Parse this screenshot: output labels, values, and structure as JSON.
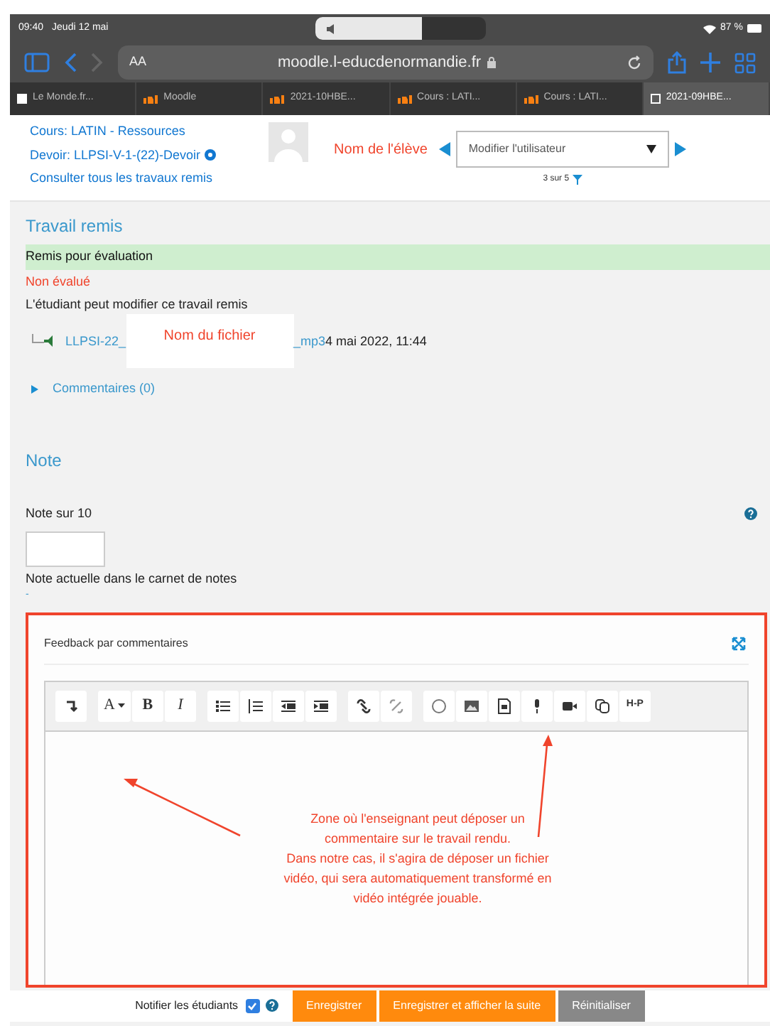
{
  "status_bar": {
    "time": "09:40",
    "date": "Jeudi 12 mai",
    "battery": "87 %"
  },
  "browser": {
    "text_size": "AA",
    "url": "moodle.l-educdenormandie.fr",
    "tabs": [
      {
        "label": "Le Monde.fr...",
        "selected": false
      },
      {
        "label": "Moodle",
        "selected": false
      },
      {
        "label": "2021-10HBE...",
        "selected": false
      },
      {
        "label": "Cours : LATI...",
        "selected": false
      },
      {
        "label": "Cours : LATI...",
        "selected": false
      },
      {
        "label": "2021-09HBE...",
        "selected": true
      }
    ]
  },
  "header": {
    "links": [
      "Cours: LATIN - Ressources",
      "Devoir: LLPSI-V-1-(22)-Devoir",
      "Consulter tous les travaux remis"
    ],
    "student_label": "Nom de l'élève",
    "user_select": "Modifier l'utilisateur",
    "counter": "3 sur 5"
  },
  "submission": {
    "title": "Travail remis",
    "status": "Remis pour évaluation",
    "grading": "Non évalué",
    "info": "L'étudiant peut modifier ce travail remis",
    "file_start": "LLPSI-22_",
    "file_end": "_mp3",
    "file_date": "4 mai 2022, 11:44",
    "file_label": "Nom du fichier",
    "comments": "Commentaires (0)",
    "comments_expanded": false
  },
  "grade": {
    "title": "Note",
    "label": "Note sur 10",
    "current_label": "Note actuelle dans le carnet de notes",
    "current_value": "-"
  },
  "feedback": {
    "title": "Feedback par commentaires",
    "toolbar": [
      [
        {
          "kind": "icon"
        }
      ],
      [
        {
          "kind": "text",
          "label": "A"
        },
        {
          "kind": "text",
          "label": "B"
        },
        {
          "kind": "text",
          "label": "I"
        }
      ],
      [
        {
          "kind": "icon"
        },
        {
          "kind": "icon"
        },
        {
          "kind": "icon"
        },
        {
          "kind": "icon"
        }
      ],
      [
        {
          "kind": "icon"
        },
        {
          "kind": "icon"
        }
      ],
      [
        {
          "kind": "icon"
        },
        {
          "kind": "icon"
        },
        {
          "kind": "icon"
        },
        {
          "kind": "icon"
        },
        {
          "kind": "icon"
        },
        {
          "kind": "icon"
        },
        {
          "kind": "text",
          "label": "H-P"
        }
      ]
    ],
    "note_lines": [
      "Zone où l'enseignant peut déposer un",
      "commentaire sur le travail rendu.",
      "Dans notre cas, il s'agira de déposer un fichier",
      "vidéo, qui sera automatiquement transformé en",
      "vidéo intégrée jouable."
    ]
  },
  "footer": {
    "notify_label": "Notifier les étudiants",
    "notify_checked": true,
    "buttons": [
      {
        "label": "Enregistrer",
        "kind": "primary"
      },
      {
        "label": "Enregistrer et afficher la suite",
        "kind": "primary"
      },
      {
        "label": "Réinitialiser",
        "kind": "secondary"
      }
    ]
  }
}
